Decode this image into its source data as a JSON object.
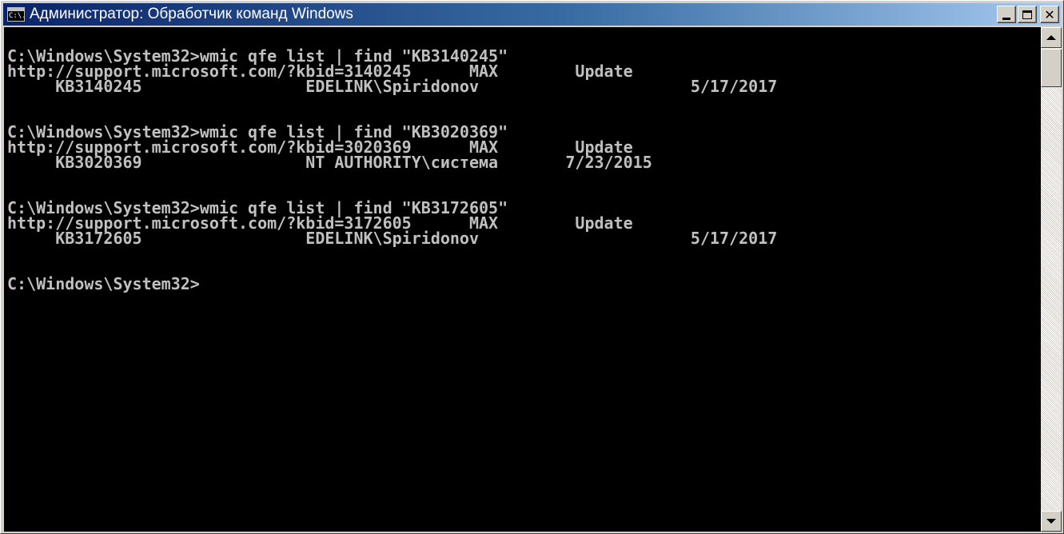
{
  "window": {
    "title": "Администратор: Обработчик команд Windows",
    "icon_text": "C:\\."
  },
  "colors": {
    "title_gradient_start": "#0a246a",
    "title_gradient_end": "#a6caf0",
    "console_bg": "#000000",
    "console_fg": "#c0c0c0",
    "chrome": "#d4d0c8"
  },
  "icons": {
    "app": "console-icon",
    "minimize": "minimize-icon",
    "maximize": "maximize-icon",
    "close": "close-icon",
    "scroll_up": "arrow-up-icon",
    "scroll_down": "arrow-down-icon"
  },
  "buttons": {
    "close_glyph": "✕"
  },
  "console": {
    "lines": [
      "C:\\Windows\\System32>wmic qfe list | find \"KB3140245\"",
      "http://support.microsoft.com/?kbid=3140245      MAX        Update",
      "     KB3140245                 EDELINK\\Spiridonov                      5/17/2017",
      "",
      "",
      "C:\\Windows\\System32>wmic qfe list | find \"KB3020369\"",
      "http://support.microsoft.com/?kbid=3020369      MAX        Update",
      "     KB3020369                 NT AUTHORITY\\система       7/23/2015",
      "",
      "",
      "C:\\Windows\\System32>wmic qfe list | find \"KB3172605\"",
      "http://support.microsoft.com/?kbid=3172605      MAX        Update",
      "     KB3172605                 EDELINK\\Spiridonov                      5/17/2017",
      "",
      "",
      "C:\\Windows\\System32>"
    ]
  }
}
